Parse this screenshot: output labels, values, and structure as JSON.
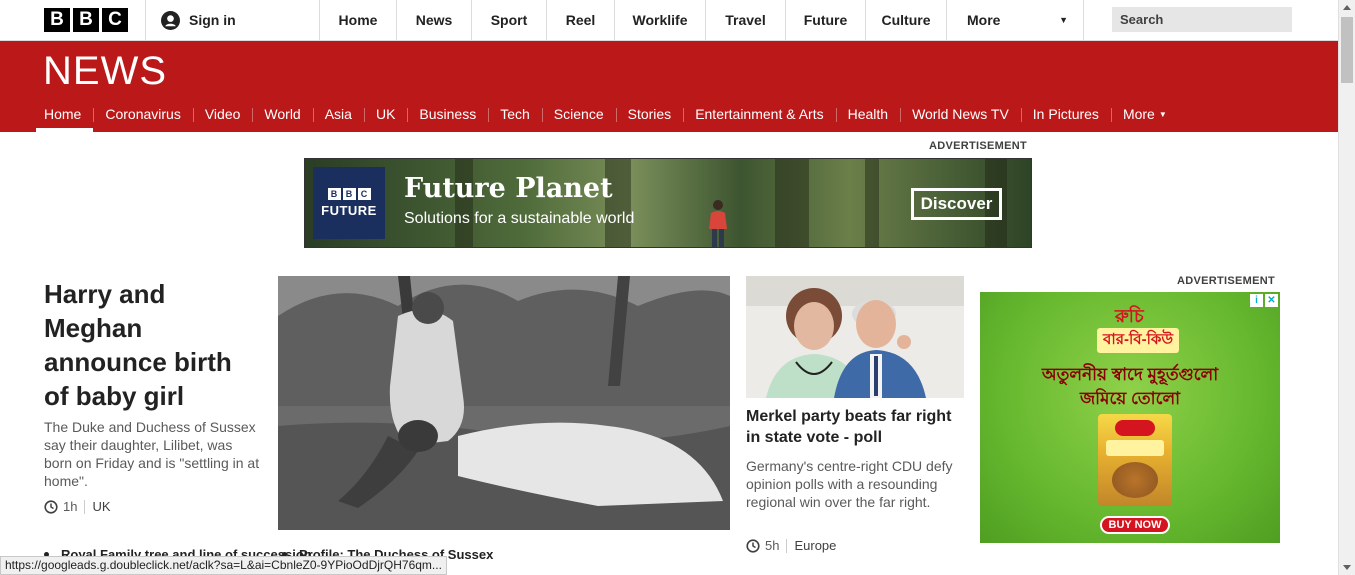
{
  "topbar": {
    "logo_letters": [
      "B",
      "B",
      "C"
    ],
    "signin_label": "Sign in",
    "nav": [
      {
        "label": "Home"
      },
      {
        "label": "News"
      },
      {
        "label": "Sport"
      },
      {
        "label": "Reel"
      },
      {
        "label": "Worklife"
      },
      {
        "label": "Travel"
      },
      {
        "label": "Future"
      },
      {
        "label": "Culture"
      }
    ],
    "more_label": "More",
    "search_placeholder": "Search"
  },
  "news_header": {
    "logo_text": "NEWS",
    "brand_color": "#bb1919",
    "sections": [
      {
        "label": "Home",
        "active": true
      },
      {
        "label": "Coronavirus"
      },
      {
        "label": "Video"
      },
      {
        "label": "World"
      },
      {
        "label": "Asia"
      },
      {
        "label": "UK"
      },
      {
        "label": "Business"
      },
      {
        "label": "Tech"
      },
      {
        "label": "Science"
      },
      {
        "label": "Stories"
      },
      {
        "label": "Entertainment & Arts"
      },
      {
        "label": "Health"
      },
      {
        "label": "World News TV"
      },
      {
        "label": "In Pictures"
      }
    ],
    "more_label": "More"
  },
  "banner_ad": {
    "label": "ADVERTISEMENT",
    "badge_letters": [
      "B",
      "B",
      "C"
    ],
    "badge_word": "FUTURE",
    "title": "Future Planet",
    "subtitle": "Solutions for a sustainable world",
    "cta": "Discover"
  },
  "lead_story": {
    "headline": "Harry and Meghan announce birth of baby girl",
    "summary": "The Duke and Duchess of Sussex say their daughter, Lilibet, was born on Friday and is \"settling in at home\".",
    "time": "1h",
    "tag": "UK",
    "related": [
      "Royal Family tree and line of succession",
      "Profile: The Duchess of Sussex"
    ]
  },
  "second_story": {
    "headline": "Merkel party beats far right in state vote - poll",
    "summary": "Germany's centre-right CDU defy opinion polls with a resounding regional win over the far right.",
    "time": "5h",
    "tag": "Europe"
  },
  "side_ad": {
    "label": "ADVERTISEMENT",
    "brand": "রুচি",
    "product": "বার-বি-কিউ",
    "line1": "অতুলনীয় স্বাদে মুহূর্তগুলো",
    "line2": "জমিয়ে তোলো",
    "cta": "BUY NOW"
  },
  "status_bar": {
    "url": "https://googleads.g.doubleclick.net/aclk?sa=L&ai=CbnleZ0-9YPioOdDjrQH76qm..."
  }
}
